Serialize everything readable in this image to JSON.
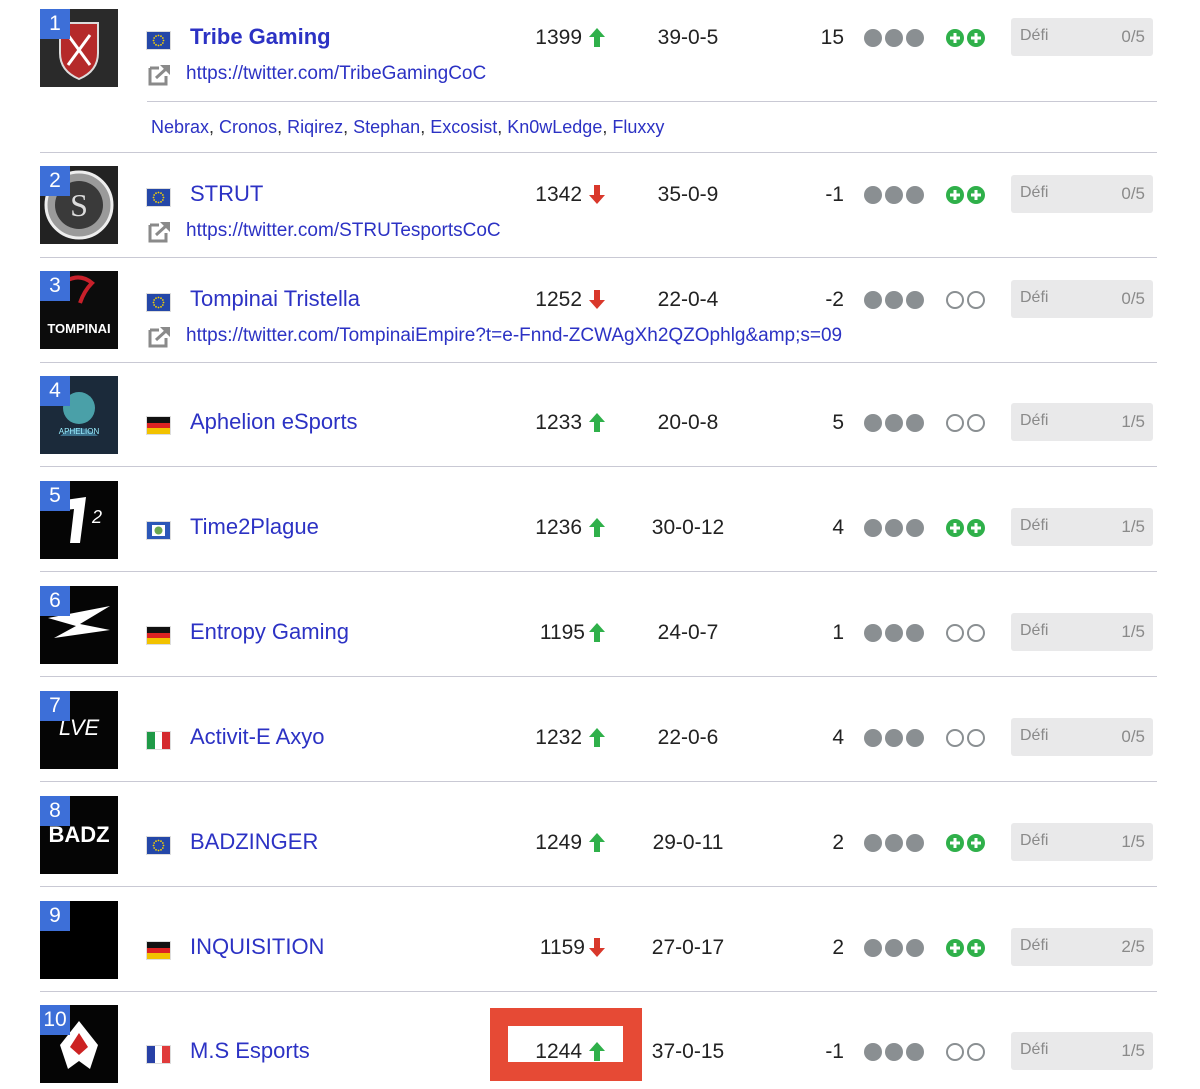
{
  "colors": {
    "link": "#2c32c4",
    "rank_badge": "#3d6fd8",
    "up": "#2fb04a",
    "down": "#d9382b",
    "dot": "#8a8f92",
    "highlight": "#e64a35"
  },
  "defi_label": "Défi",
  "teams": [
    {
      "rank": "1",
      "name": "Tribe Gaming",
      "flag": "eu-flag",
      "elo": "1399",
      "trend": "up",
      "record": "39-0-5",
      "diff": "15",
      "status": "plus",
      "defi": "0/5",
      "url": "https://twitter.com/TribeGamingCoC",
      "players": [
        "Nebrax",
        "Cronos",
        "Riqirez",
        "Stephan",
        "Excosist",
        "Kn0wLedge",
        "Fluxxy"
      ]
    },
    {
      "rank": "2",
      "name": "STRUT",
      "flag": "eu-flag",
      "elo": "1342",
      "trend": "down",
      "record": "35-0-9",
      "diff": "-1",
      "status": "plus",
      "defi": "0/5",
      "url": "https://twitter.com/STRUTesportsCoC"
    },
    {
      "rank": "3",
      "name": "Tompinai Tristella",
      "flag": "eu-flag",
      "elo": "1252",
      "trend": "down",
      "record": "22-0-4",
      "diff": "-2",
      "status": "empty",
      "defi": "0/5",
      "url": "https://twitter.com/TompinaiEmpire?t=e-Fnnd-ZCWAgXh2QZOphlg&amp;s=09"
    },
    {
      "rank": "4",
      "name": "Aphelion eSports",
      "flag": "germany-flag",
      "elo": "1233",
      "trend": "up",
      "record": "20-0-8",
      "diff": "5",
      "status": "empty",
      "defi": "1/5"
    },
    {
      "rank": "5",
      "name": "Time2Plague",
      "flag": "world-flag",
      "elo": "1236",
      "trend": "up",
      "record": "30-0-12",
      "diff": "4",
      "status": "plus",
      "defi": "1/5"
    },
    {
      "rank": "6",
      "name": "Entropy Gaming",
      "flag": "germany-flag",
      "elo": "1195",
      "trend": "up",
      "record": "24-0-7",
      "diff": "1",
      "status": "empty",
      "defi": "1/5"
    },
    {
      "rank": "7",
      "name": "Activit-E Axyo",
      "flag": "italy-flag",
      "elo": "1232",
      "trend": "up",
      "record": "22-0-6",
      "diff": "4",
      "status": "empty",
      "defi": "0/5"
    },
    {
      "rank": "8",
      "name": "BADZINGER",
      "flag": "eu-flag",
      "elo": "1249",
      "trend": "up",
      "record": "29-0-11",
      "diff": "2",
      "status": "plus",
      "defi": "1/5"
    },
    {
      "rank": "9",
      "name": "INQUISITION",
      "flag": "germany-flag",
      "elo": "1159",
      "trend": "down",
      "record": "27-0-17",
      "diff": "2",
      "status": "plus",
      "defi": "2/5"
    },
    {
      "rank": "10",
      "name": "M.S Esports",
      "flag": "france-flag",
      "elo": "1244",
      "trend": "up",
      "record": "37-0-15",
      "diff": "-1",
      "status": "empty",
      "defi": "1/5"
    }
  ]
}
